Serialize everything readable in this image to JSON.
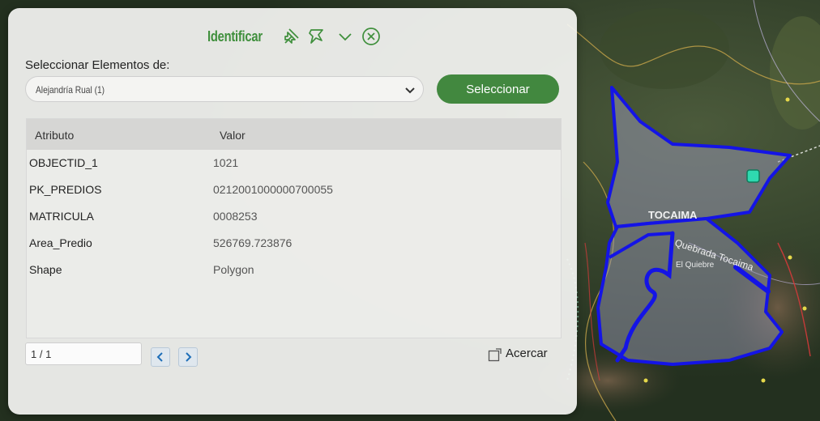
{
  "colors": {
    "accent_green": "#42883f",
    "title_green": "#3f8f3c",
    "polygon_outline": "#1414e6",
    "selected_marker": "#2fd9b0"
  },
  "header": {
    "title": "Identificar",
    "icons": [
      "pin-icon",
      "pin-outline-icon",
      "chevron-down-icon",
      "close-circle-icon"
    ]
  },
  "selector": {
    "label": "Seleccionar Elementos de:",
    "value": "Alejandría Rual (1)",
    "button_label": "Seleccionar"
  },
  "table": {
    "headers": [
      "Atributo",
      "Valor"
    ],
    "rows": [
      {
        "attr": "OBJECTID_1",
        "value": "1021"
      },
      {
        "attr": "PK_PREDIOS",
        "value": "0212001000000700055"
      },
      {
        "attr": "MATRICULA",
        "value": "0008253"
      },
      {
        "attr": "Area_Predio",
        "value": "526769.723876"
      },
      {
        "attr": "Shape",
        "value": "Polygon"
      }
    ]
  },
  "pagination": {
    "page_text": "1 / 1"
  },
  "zoom": {
    "label": "Acercar"
  },
  "map": {
    "labels": [
      "TOCAIMA",
      "Quebrada Tocaima",
      "El Quiebre"
    ]
  }
}
